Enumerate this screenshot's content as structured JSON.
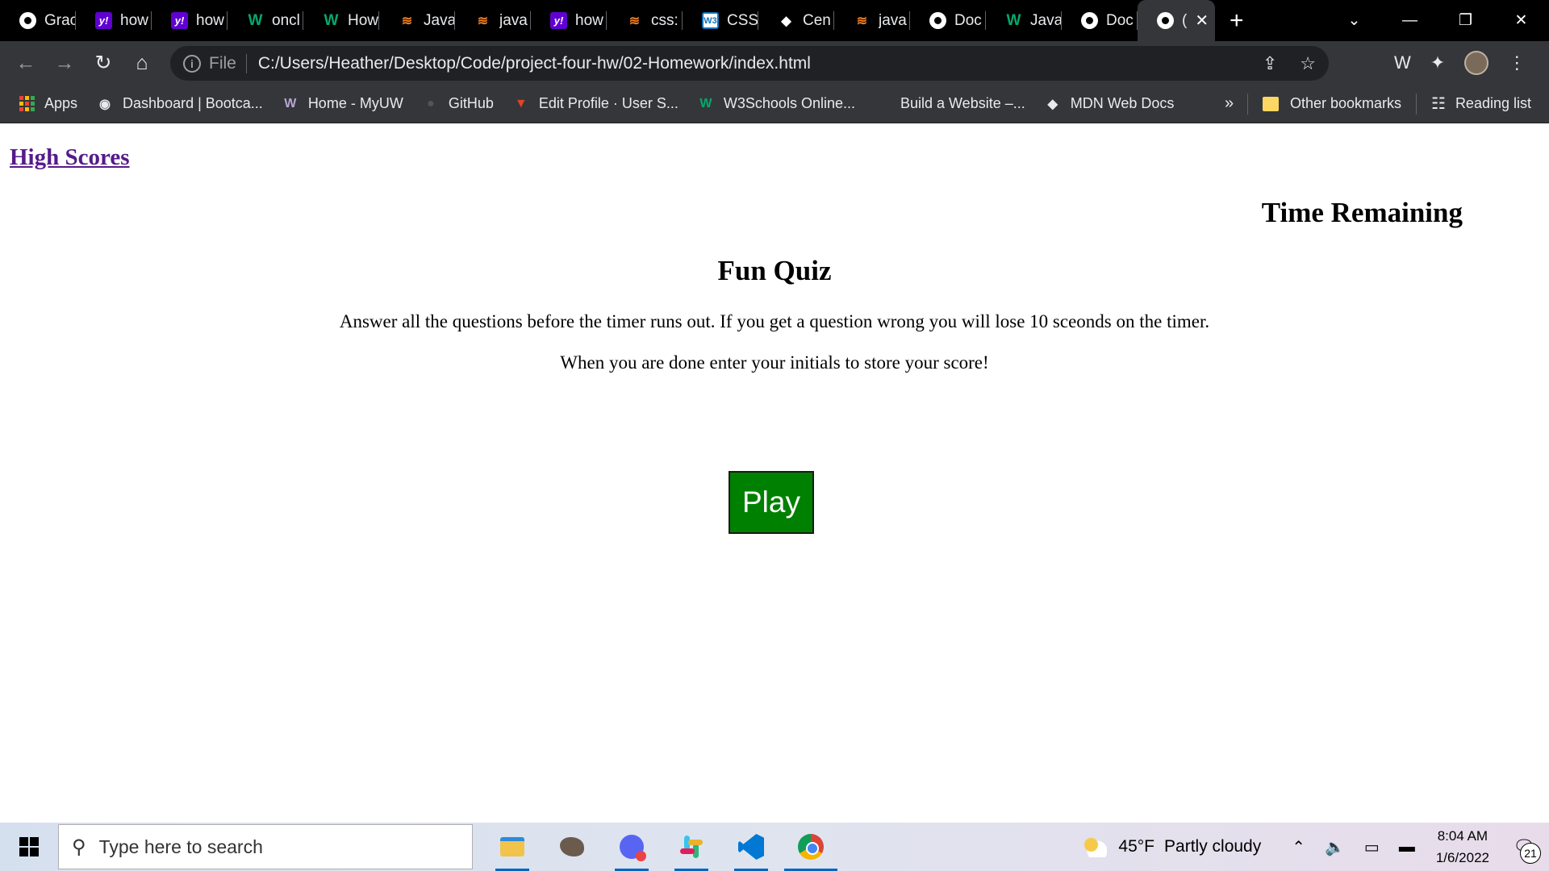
{
  "browser": {
    "tabs": [
      {
        "favicon": "globe-icon",
        "title": "Grac"
      },
      {
        "favicon": "yahoo-icon",
        "title": "how"
      },
      {
        "favicon": "yahoo-icon",
        "title": "how"
      },
      {
        "favicon": "w3schools-icon",
        "title": "oncl"
      },
      {
        "favicon": "w3schools-icon",
        "title": "How"
      },
      {
        "favicon": "stackoverflow-icon",
        "title": "Java"
      },
      {
        "favicon": "stackoverflow-icon",
        "title": "java"
      },
      {
        "favicon": "yahoo-icon",
        "title": "how"
      },
      {
        "favicon": "stackoverflow-icon",
        "title": "css:"
      },
      {
        "favicon": "css-icon",
        "title": "CSS:"
      },
      {
        "favicon": "cengage-icon",
        "title": "Cen"
      },
      {
        "favicon": "stackoverflow-icon",
        "title": "java"
      },
      {
        "favicon": "globe-icon",
        "title": "Doc"
      },
      {
        "favicon": "w3schools-icon",
        "title": "Java"
      },
      {
        "favicon": "globe-icon",
        "title": "Doc"
      },
      {
        "favicon": "globe-icon",
        "title": "(",
        "active": true
      }
    ],
    "address": {
      "scheme": "File",
      "url": "C:/Users/Heather/Desktop/Code/project-four-hw/02-Homework/index.html"
    },
    "bookmarks": [
      {
        "icon": "apps-icon",
        "label": "Apps"
      },
      {
        "icon": "globe-icon",
        "label": "Dashboard | Bootca..."
      },
      {
        "icon": "uw-icon",
        "label": "Home - MyUW"
      },
      {
        "icon": "github-icon",
        "label": "GitHub"
      },
      {
        "icon": "gitlab-icon",
        "label": "Edit Profile · User S..."
      },
      {
        "icon": "w3schools-icon",
        "label": "W3Schools Online..."
      },
      {
        "icon": "blank-icon",
        "label": "Build a Website –..."
      },
      {
        "icon": "mdn-icon",
        "label": "MDN Web Docs"
      }
    ],
    "bookmarks_overflow": "»",
    "other_bookmarks": "Other bookmarks",
    "reading_list": "Reading list"
  },
  "page": {
    "high_scores_link": "High Scores",
    "timer_label": "Time Remaining",
    "title": "Fun Quiz",
    "intro_line1": "Answer all the questions before the timer runs out. If you get a question wrong you will lose 10 sceonds on the timer.",
    "intro_line2": "When you are done enter your initials to store your score!",
    "play_button": "Play",
    "link_color": "#551a8b",
    "button_color": "#008000"
  },
  "taskbar": {
    "search_placeholder": "Type here to search",
    "apps": [
      "file-explorer-icon",
      "gimp-icon",
      "discord-icon",
      "slack-icon",
      "vscode-icon",
      "chrome-icon"
    ],
    "weather_temp": "45°F",
    "weather_desc": "Partly cloudy",
    "time": "8:04 AM",
    "date": "1/6/2022",
    "notification_count": "21"
  }
}
